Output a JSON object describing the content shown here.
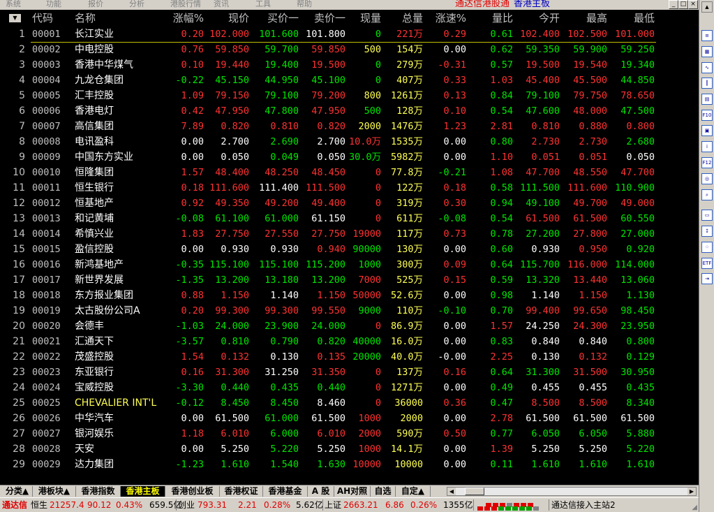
{
  "menu": {
    "items": [
      "系统",
      "功能",
      "报价",
      "分析",
      "港股行情",
      "资讯",
      "工具",
      "帮助"
    ],
    "title": "通达信港股通",
    "subtitle": "香港主板"
  },
  "header": {
    "sort_icon": "sort-desc-icon",
    "columns": [
      "代码",
      "名称",
      "涨幅%",
      "现价",
      "买价一",
      "卖价一",
      "现量",
      "总量",
      "涨速%",
      "量比",
      "今开",
      "最高",
      "最低"
    ]
  },
  "rows": [
    [
      "1",
      "00001",
      "长江实业",
      "0.20",
      "102.000",
      "101.600",
      "101.800",
      "0",
      "221万",
      "0.29",
      "0.61",
      "102.400",
      "102.500",
      "101.000"
    ],
    [
      "2",
      "00002",
      "中电控股",
      "0.76",
      "59.850",
      "59.700",
      "59.850",
      "500",
      "154万",
      "0.00",
      "0.62",
      "59.350",
      "59.900",
      "59.250"
    ],
    [
      "3",
      "00003",
      "香港中华煤气",
      "0.10",
      "19.440",
      "19.400",
      "19.500",
      "0",
      "279万",
      "-0.31",
      "0.57",
      "19.500",
      "19.540",
      "19.340"
    ],
    [
      "4",
      "00004",
      "九龙仓集团",
      "-0.22",
      "45.150",
      "44.950",
      "45.100",
      "0",
      "407万",
      "0.33",
      "1.03",
      "45.400",
      "45.500",
      "44.850"
    ],
    [
      "5",
      "00005",
      "汇丰控股",
      "1.09",
      "79.150",
      "79.100",
      "79.200",
      "800",
      "1261万",
      "0.13",
      "0.84",
      "79.100",
      "79.750",
      "78.650"
    ],
    [
      "6",
      "00006",
      "香港电灯",
      "0.42",
      "47.950",
      "47.800",
      "47.950",
      "500",
      "128万",
      "0.10",
      "0.54",
      "47.600",
      "48.000",
      "47.500"
    ],
    [
      "7",
      "00007",
      "高信集团",
      "7.89",
      "0.820",
      "0.810",
      "0.820",
      "2000",
      "1476万",
      "1.23",
      "2.81",
      "0.810",
      "0.880",
      "0.800"
    ],
    [
      "8",
      "00008",
      "电讯盈科",
      "0.00",
      "2.700",
      "2.690",
      "2.700",
      "10.0万",
      "1535万",
      "0.00",
      "0.80",
      "2.730",
      "2.730",
      "2.680"
    ],
    [
      "9",
      "00009",
      "中国东方实业",
      "0.00",
      "0.050",
      "0.049",
      "0.050",
      "30.0万",
      "5982万",
      "0.00",
      "1.10",
      "0.051",
      "0.051",
      "0.050"
    ],
    [
      "10",
      "00010",
      "恒隆集团",
      "1.57",
      "48.400",
      "48.250",
      "48.450",
      "0",
      "77.8万",
      "-0.21",
      "1.08",
      "47.700",
      "48.550",
      "47.700"
    ],
    [
      "11",
      "00011",
      "恒生银行",
      "0.18",
      "111.600",
      "111.400",
      "111.500",
      "0",
      "122万",
      "0.18",
      "0.58",
      "111.500",
      "111.600",
      "110.900"
    ],
    [
      "12",
      "00012",
      "恒基地产",
      "0.92",
      "49.350",
      "49.200",
      "49.400",
      "0",
      "319万",
      "0.30",
      "0.94",
      "49.100",
      "49.700",
      "49.000"
    ],
    [
      "13",
      "00013",
      "和记黄埔",
      "-0.08",
      "61.100",
      "61.000",
      "61.150",
      "0",
      "611万",
      "-0.08",
      "0.54",
      "61.500",
      "61.500",
      "60.550"
    ],
    [
      "14",
      "00014",
      "希慎兴业",
      "1.83",
      "27.750",
      "27.550",
      "27.750",
      "19000",
      "117万",
      "0.73",
      "0.78",
      "27.200",
      "27.800",
      "27.000"
    ],
    [
      "15",
      "00015",
      "盈信控股",
      "0.00",
      "0.930",
      "0.930",
      "0.940",
      "90000",
      "130万",
      "0.00",
      "0.60",
      "0.930",
      "0.950",
      "0.920"
    ],
    [
      "16",
      "00016",
      "新鸿基地产",
      "-0.35",
      "115.100",
      "115.100",
      "115.200",
      "1000",
      "300万",
      "0.09",
      "0.64",
      "115.700",
      "116.000",
      "114.000"
    ],
    [
      "17",
      "00017",
      "新世界发展",
      "-1.35",
      "13.200",
      "13.180",
      "13.200",
      "7000",
      "525万",
      "0.15",
      "0.59",
      "13.320",
      "13.440",
      "13.060"
    ],
    [
      "18",
      "00018",
      "东方报业集团",
      "0.88",
      "1.150",
      "1.140",
      "1.150",
      "50000",
      "52.6万",
      "0.00",
      "0.98",
      "1.140",
      "1.150",
      "1.130"
    ],
    [
      "19",
      "00019",
      "太古股份公司A",
      "0.20",
      "99.300",
      "99.300",
      "99.550",
      "9000",
      "110万",
      "-0.10",
      "0.70",
      "99.400",
      "99.650",
      "98.450"
    ],
    [
      "20",
      "00020",
      "会德丰",
      "-1.03",
      "24.000",
      "23.900",
      "24.000",
      "0",
      "86.9万",
      "0.00",
      "1.57",
      "24.250",
      "24.300",
      "23.950"
    ],
    [
      "21",
      "00021",
      "汇通天下",
      "-3.57",
      "0.810",
      "0.790",
      "0.820",
      "40000",
      "16.0万",
      "0.00",
      "0.83",
      "0.840",
      "0.840",
      "0.800"
    ],
    [
      "22",
      "00022",
      "茂盛控股",
      "1.54",
      "0.132",
      "0.130",
      "0.135",
      "20000",
      "40.0万",
      "-0.00",
      "2.25",
      "0.130",
      "0.132",
      "0.129"
    ],
    [
      "23",
      "00023",
      "东亚银行",
      "0.16",
      "31.300",
      "31.250",
      "31.350",
      "0",
      "137万",
      "0.16",
      "0.64",
      "31.300",
      "31.500",
      "30.950"
    ],
    [
      "24",
      "00024",
      "宝威控股",
      "-3.30",
      "0.440",
      "0.435",
      "0.440",
      "0",
      "1271万",
      "0.00",
      "0.49",
      "0.455",
      "0.455",
      "0.435"
    ],
    [
      "25",
      "00025",
      "CHEVALIER INT'L",
      "-0.12",
      "8.450",
      "8.450",
      "8.460",
      "0",
      "36000",
      "0.36",
      "0.47",
      "8.500",
      "8.500",
      "8.340"
    ],
    [
      "26",
      "00026",
      "中华汽车",
      "0.00",
      "61.500",
      "61.000",
      "61.500",
      "1000",
      "2000",
      "0.00",
      "2.78",
      "61.500",
      "61.500",
      "61.500"
    ],
    [
      "27",
      "00027",
      "银河娱乐",
      "1.18",
      "6.010",
      "6.000",
      "6.010",
      "2000",
      "590万",
      "0.50",
      "0.77",
      "6.050",
      "6.050",
      "5.880"
    ],
    [
      "28",
      "00028",
      "天安",
      "0.00",
      "5.250",
      "5.220",
      "5.250",
      "1000",
      "14.1万",
      "0.00",
      "1.39",
      "5.250",
      "5.250",
      "5.220"
    ],
    [
      "29",
      "00029",
      "达力集团",
      "-1.23",
      "1.610",
      "1.540",
      "1.630",
      "10000",
      "10000",
      "0.00",
      "0.11",
      "1.610",
      "1.610",
      "1.610"
    ]
  ],
  "row_colors": [
    [
      "red",
      "red",
      "green",
      "white",
      "green",
      "red",
      "red",
      "green",
      "red",
      "red",
      "red"
    ],
    [
      "red",
      "red",
      "green",
      "red",
      "yellow",
      "yellow",
      "white",
      "green",
      "green",
      "green",
      "green"
    ],
    [
      "red",
      "red",
      "green",
      "red",
      "green",
      "yellow",
      "red",
      "green",
      "red",
      "red",
      "green"
    ],
    [
      "green",
      "green",
      "green",
      "green",
      "green",
      "yellow",
      "red",
      "red",
      "red",
      "red",
      "green"
    ],
    [
      "red",
      "red",
      "green",
      "red",
      "yellow",
      "yellow",
      "red",
      "green",
      "green",
      "red",
      "red"
    ],
    [
      "red",
      "red",
      "green",
      "red",
      "green",
      "yellow",
      "red",
      "green",
      "green",
      "red",
      "green"
    ],
    [
      "red",
      "red",
      "red",
      "red",
      "yellow",
      "yellow",
      "red",
      "red",
      "red",
      "red",
      "red"
    ],
    [
      "white",
      "white",
      "green",
      "white",
      "red",
      "yellow",
      "white",
      "green",
      "red",
      "red",
      "green"
    ],
    [
      "white",
      "white",
      "green",
      "white",
      "green",
      "yellow",
      "white",
      "red",
      "red",
      "red",
      "white"
    ],
    [
      "red",
      "red",
      "red",
      "red",
      "red",
      "yellow",
      "green",
      "red",
      "red",
      "red",
      "red"
    ],
    [
      "red",
      "red",
      "white",
      "red",
      "red",
      "yellow",
      "red",
      "green",
      "green",
      "red",
      "green"
    ],
    [
      "red",
      "red",
      "red",
      "red",
      "red",
      "yellow",
      "red",
      "green",
      "green",
      "red",
      "red"
    ],
    [
      "green",
      "green",
      "green",
      "white",
      "red",
      "yellow",
      "green",
      "green",
      "red",
      "red",
      "green"
    ],
    [
      "red",
      "red",
      "red",
      "red",
      "red",
      "yellow",
      "red",
      "green",
      "green",
      "red",
      "green"
    ],
    [
      "white",
      "white",
      "white",
      "red",
      "green",
      "yellow",
      "white",
      "green",
      "white",
      "red",
      "green"
    ],
    [
      "green",
      "green",
      "green",
      "green",
      "green",
      "yellow",
      "red",
      "green",
      "green",
      "red",
      "green"
    ],
    [
      "green",
      "green",
      "green",
      "green",
      "red",
      "yellow",
      "red",
      "green",
      "green",
      "red",
      "green"
    ],
    [
      "red",
      "red",
      "white",
      "red",
      "red",
      "yellow",
      "white",
      "green",
      "white",
      "red",
      "green"
    ],
    [
      "red",
      "red",
      "red",
      "red",
      "green",
      "yellow",
      "green",
      "green",
      "red",
      "red",
      "green"
    ],
    [
      "green",
      "green",
      "green",
      "green",
      "red",
      "yellow",
      "white",
      "red",
      "white",
      "red",
      "green"
    ],
    [
      "green",
      "green",
      "green",
      "green",
      "green",
      "yellow",
      "white",
      "green",
      "white",
      "white",
      "green"
    ],
    [
      "red",
      "red",
      "white",
      "red",
      "green",
      "yellow",
      "white",
      "red",
      "white",
      "red",
      "green"
    ],
    [
      "red",
      "red",
      "white",
      "red",
      "red",
      "yellow",
      "red",
      "green",
      "green",
      "red",
      "green"
    ],
    [
      "green",
      "green",
      "green",
      "green",
      "red",
      "yellow",
      "white",
      "green",
      "white",
      "white",
      "green"
    ],
    [
      "green",
      "green",
      "green",
      "white",
      "red",
      "yellow",
      "red",
      "green",
      "red",
      "red",
      "green"
    ],
    [
      "white",
      "white",
      "green",
      "white",
      "red",
      "yellow",
      "white",
      "red",
      "white",
      "white",
      "white"
    ],
    [
      "red",
      "red",
      "green",
      "red",
      "red",
      "yellow",
      "red",
      "green",
      "green",
      "green",
      "green"
    ],
    [
      "white",
      "white",
      "green",
      "white",
      "red",
      "yellow",
      "white",
      "red",
      "white",
      "white",
      "green"
    ],
    [
      "green",
      "green",
      "green",
      "green",
      "red",
      "yellow",
      "white",
      "green",
      "green",
      "green",
      "green"
    ]
  ],
  "tabs": [
    "分类▲",
    "港板块▲",
    "香港指数",
    "香港主板",
    "香港创业板",
    "香港权证",
    "香港基金",
    "A 股",
    "AH对照",
    "自选",
    "自定▲"
  ],
  "active_tab": 3,
  "status": {
    "brand": "通达信",
    "idx1_name": "恒生",
    "idx1_value": "21257.4",
    "idx1_change": "90.12",
    "idx1_pct": "0.43%",
    "idx1_amount": "659.5亿",
    "idx2_name": "创业",
    "idx2_value": "793.31",
    "idx2_change": "2.21",
    "idx2_pct": "0.28%",
    "idx2_amount": "5.62亿",
    "idx3_name": "上证",
    "idx3_value": "2663.21",
    "idx3_change": "6.86",
    "idx3_pct": "0.26%",
    "idx3_amount": "1355亿",
    "connection": "通达信接入主站2"
  },
  "side_icons": [
    "list-icon",
    "grid-icon",
    "chart-line-icon",
    "candlestick-icon",
    "table-icon",
    "f10-icon",
    "news-icon",
    "info-icon",
    "f12-icon",
    "f10-circle-icon",
    "search-icon",
    "folder-icon",
    "sort-icon",
    "dice-icon",
    "etf-icon",
    "exit-icon"
  ],
  "colors": {
    "up": "#ff3232",
    "down": "#00e600",
    "flat": "#ffffff",
    "volume": "#ffff54",
    "header": "#c0c0c0",
    "active_tab_text": "#ffff00"
  }
}
